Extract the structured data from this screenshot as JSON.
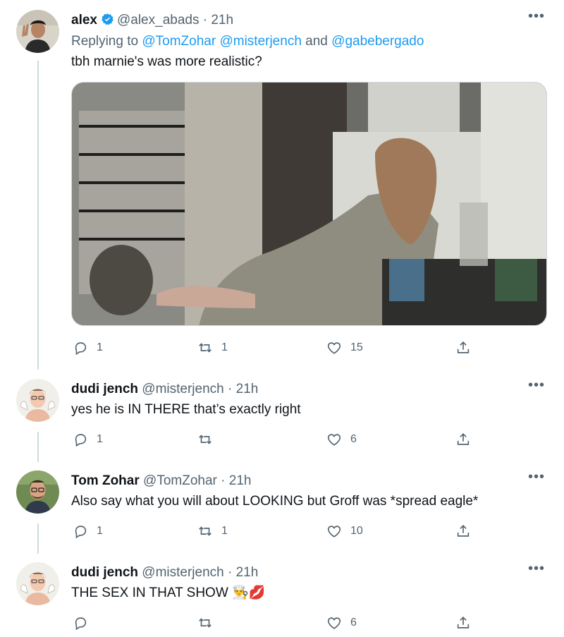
{
  "tweets": [
    {
      "name": "alex",
      "handle": "@alex_abads",
      "time": "21h",
      "verified": true,
      "reply_prefix": "Replying to ",
      "reply_mention_1": "@TomZohar",
      "reply_mention_2": "@misterjench",
      "reply_and": " and ",
      "reply_mention_3": "@gabebergado",
      "text": "tbh marnie's was more realistic?",
      "replies": "1",
      "retweets": "1",
      "likes": "15"
    },
    {
      "name": "dudi jench",
      "handle": "@misterjench",
      "time": "21h",
      "text": "yes he is IN THERE that’s exactly right",
      "replies": "1",
      "retweets": "",
      "likes": "6"
    },
    {
      "name": "Tom Zohar",
      "handle": "@TomZohar",
      "time": "21h",
      "text": "Also say what you will about LOOKING but Groff was *spread eagle*",
      "replies": "1",
      "retweets": "1",
      "likes": "10"
    },
    {
      "name": "dudi jench",
      "handle": "@misterjench",
      "time": "21h",
      "text": "THE SEX IN THAT SHOW",
      "emoji": "👨‍🍳💋",
      "replies": "",
      "retweets": "",
      "likes": "6"
    }
  ],
  "ui": {
    "dot": " · ",
    "more": "•••"
  },
  "icons": {
    "reply": "reply-icon",
    "retweet": "retweet-icon",
    "like": "heart-icon",
    "share": "share-icon",
    "verified": "verified-badge-icon",
    "more": "more-options-icon"
  },
  "colors": {
    "accent": "#1d9bf0",
    "muted": "#536471",
    "text": "#0f1419",
    "thread_line": "#cfd9de"
  }
}
